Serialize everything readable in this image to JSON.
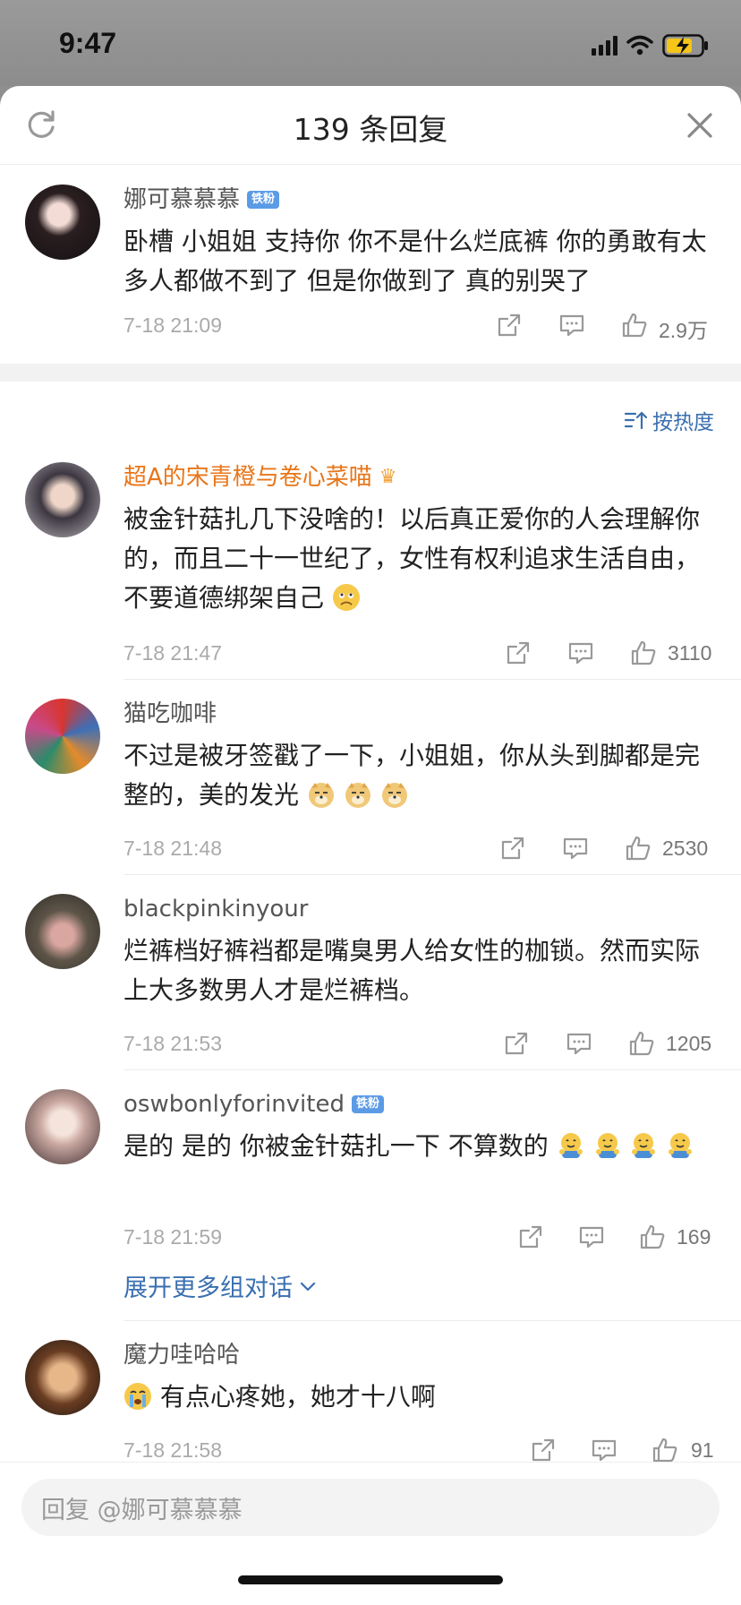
{
  "status_bar": {
    "time": "9:47"
  },
  "header": {
    "title": "139 条回复"
  },
  "sort": {
    "label": "按热度"
  },
  "expand": {
    "label": "展开更多组对话"
  },
  "reply": {
    "placeholder": "回复 @娜可慕慕慕"
  },
  "colors": {
    "link": "#3a6fb0",
    "vip_name": "#e8761a",
    "badge": "#5b9be6"
  },
  "main_comment": {
    "name": "娜可慕慕慕",
    "badge": "铁粉",
    "text": "卧槽 小姐姐 支持你 你不是什么烂底裤 你的勇敢有太多人都做不到了 但是你做到了 真的别哭了",
    "time": "7-18 21:09",
    "likes": "2.9万"
  },
  "comments": [
    {
      "name": "超A的宋青橙与卷心菜喵",
      "text": "被金针菇扎几下没啥的！以后真正爱你的人会理解你的，而且二十一世纪了，女性有权利追求生活自由，不要道德绑架自己",
      "time": "7-18 21:47",
      "likes": "3110"
    },
    {
      "name": "猫吃咖啡",
      "text": "不过是被牙签戳了一下，小姐姐，你从头到脚都是完整的，美的发光",
      "time": "7-18 21:48",
      "likes": "2530"
    },
    {
      "name": "blackpinkinyour",
      "text": "烂裤档好裤裆都是嘴臭男人给女性的枷锁。然而实际上大多数男人才是烂裤档。",
      "time": "7-18 21:53",
      "likes": "1205"
    },
    {
      "name": "oswbonlyforinvited",
      "badge": "铁粉",
      "text": "是的 是的 你被金针菇扎一下 不算数的",
      "time": "7-18 21:59",
      "likes": "169"
    },
    {
      "name": "魔力哇哈哈",
      "text": "有点心疼她，她才十八啊",
      "time": "7-18 21:58",
      "likes": "91"
    }
  ]
}
